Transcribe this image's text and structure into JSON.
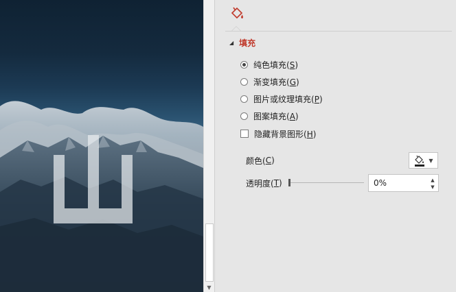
{
  "pane": {
    "section_title": "填充",
    "fill_options": [
      {
        "label_main": "纯色填充(",
        "key": "S",
        "label_end": ")",
        "checked": true
      },
      {
        "label_main": "渐变填充(",
        "key": "G",
        "label_end": ")",
        "checked": false
      },
      {
        "label_main": "图片或纹理填充(",
        "key": "P",
        "label_end": ")",
        "checked": false
      },
      {
        "label_main": "图案填充(",
        "key": "A",
        "label_end": ")",
        "checked": false
      }
    ],
    "hide_bg": {
      "label_main": "隐藏背景图形(",
      "key": "H",
      "label_end": ")",
      "checked": false
    },
    "color": {
      "label_main": "颜色(",
      "key": "C",
      "label_end": ")"
    },
    "transparency": {
      "label_main": "透明度(",
      "key": "T",
      "label_end": ")",
      "value": "0%",
      "level": 0
    }
  },
  "slide": {
    "logo_glyph": "山"
  },
  "colors": {
    "accent": "#c0392b",
    "pane_bg": "#e6e6e6"
  },
  "icons": {
    "fill_tab": "paint-bucket-icon",
    "color_button": "paint-bucket-icon"
  }
}
